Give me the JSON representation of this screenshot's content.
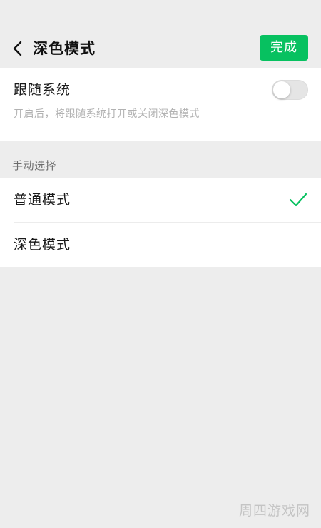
{
  "navbar": {
    "back_icon": "chevron-left-icon",
    "title": "深色模式",
    "done_label": "完成"
  },
  "follow_system": {
    "label": "跟随系统",
    "description": "开启后，将跟随系统打开或关闭深色模式",
    "enabled": false
  },
  "manual_section": {
    "header": "手动选择",
    "options": [
      {
        "label": "普通模式",
        "selected": true
      },
      {
        "label": "深色模式",
        "selected": false
      }
    ],
    "check_icon": "checkmark-icon"
  },
  "watermark": {
    "text": "周四游戏网"
  },
  "colors": {
    "accent": "#07C160",
    "background": "#EDEDED",
    "card": "#FFFFFF",
    "secondary_text": "#B2B2B2"
  }
}
